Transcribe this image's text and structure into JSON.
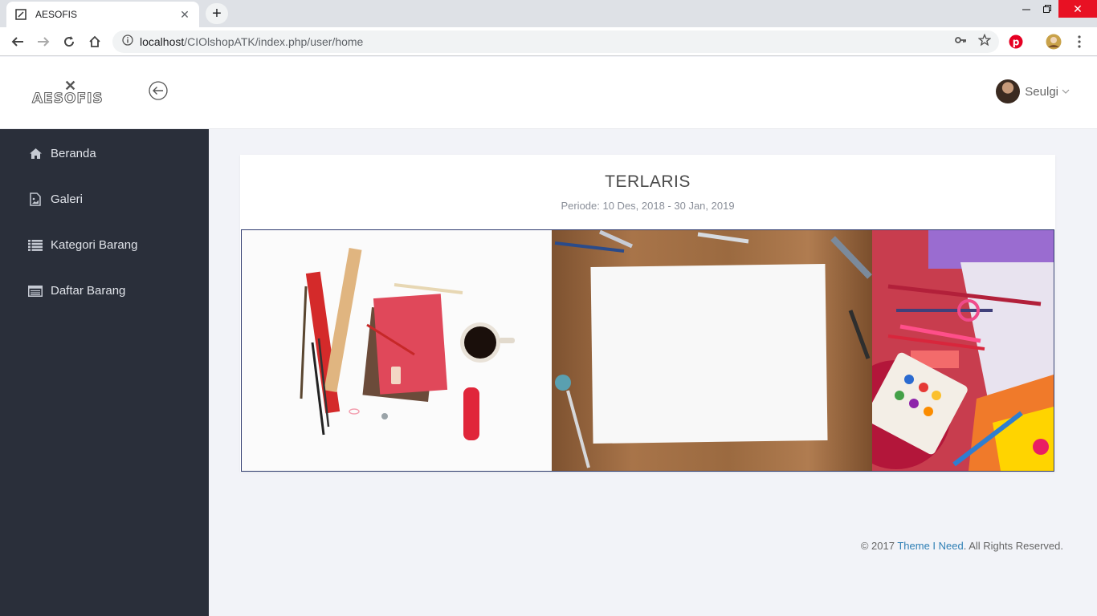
{
  "browser": {
    "tab_title": "AESOFIS",
    "url_host": "localhost",
    "url_path": "/CIOlshopATK/index.php/user/home"
  },
  "header": {
    "logo_text": "AESOFIS",
    "user_name": "Seulgi"
  },
  "sidebar": {
    "items": [
      {
        "label": "Beranda",
        "icon": "home-icon"
      },
      {
        "label": "Galeri",
        "icon": "image-icon"
      },
      {
        "label": "Kategori Barang",
        "icon": "list-icon"
      },
      {
        "label": "Daftar Barang",
        "icon": "table-icon"
      }
    ]
  },
  "main": {
    "title": "TERLARIS",
    "period": "Periode: 10 Des, 2018 - 30 Jan, 2019"
  },
  "footer": {
    "prefix": "© 2017 ",
    "link": "Theme I Need",
    "suffix": ". All Rights Reserved."
  },
  "colors": {
    "sidebar_bg": "#2a2f3a",
    "page_bg": "#f2f3f8",
    "footer_link": "#2f7fb5"
  }
}
